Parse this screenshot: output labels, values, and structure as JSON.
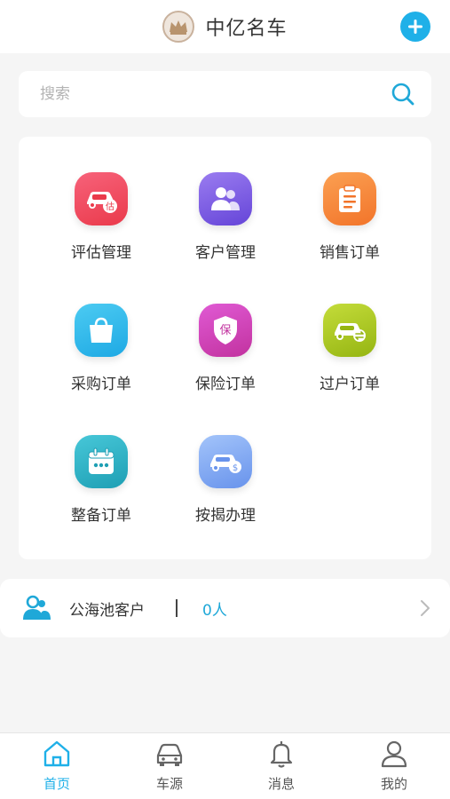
{
  "app": {
    "title": "中亿名车"
  },
  "search": {
    "placeholder": "搜索"
  },
  "menu": {
    "items": [
      {
        "label": "评估管理",
        "icon": "car-appraisal-icon",
        "color": "#f0485d"
      },
      {
        "label": "客户管理",
        "icon": "customers-icon",
        "color": "#7a5fe0"
      },
      {
        "label": "销售订单",
        "icon": "clipboard-icon",
        "color": "#f7853a"
      },
      {
        "label": "采购订单",
        "icon": "shopping-bag-icon",
        "color": "#2fb9ea"
      },
      {
        "label": "保险订单",
        "icon": "insurance-shield-icon",
        "color": "#d33fc2"
      },
      {
        "label": "过户订单",
        "icon": "car-transfer-icon",
        "color": "#a8c81e"
      },
      {
        "label": "整备订单",
        "icon": "calendar-icon",
        "color": "#2ab3c6"
      },
      {
        "label": "按揭办理",
        "icon": "car-loan-icon",
        "color": "#7ea7f2"
      }
    ]
  },
  "pool": {
    "label": "公海池客户",
    "divider": "|",
    "count": "0人",
    "icon": "customers-icon"
  },
  "tabbar": {
    "tabs": [
      {
        "label": "首页",
        "icon": "home-icon"
      },
      {
        "label": "车源",
        "icon": "car-icon"
      },
      {
        "label": "消息",
        "icon": "bell-icon"
      },
      {
        "label": "我的",
        "icon": "user-icon"
      }
    ],
    "active_label": "首页"
  },
  "colors": {
    "accent": "#1fb0e8",
    "page_bg": "#f5f5f5"
  }
}
